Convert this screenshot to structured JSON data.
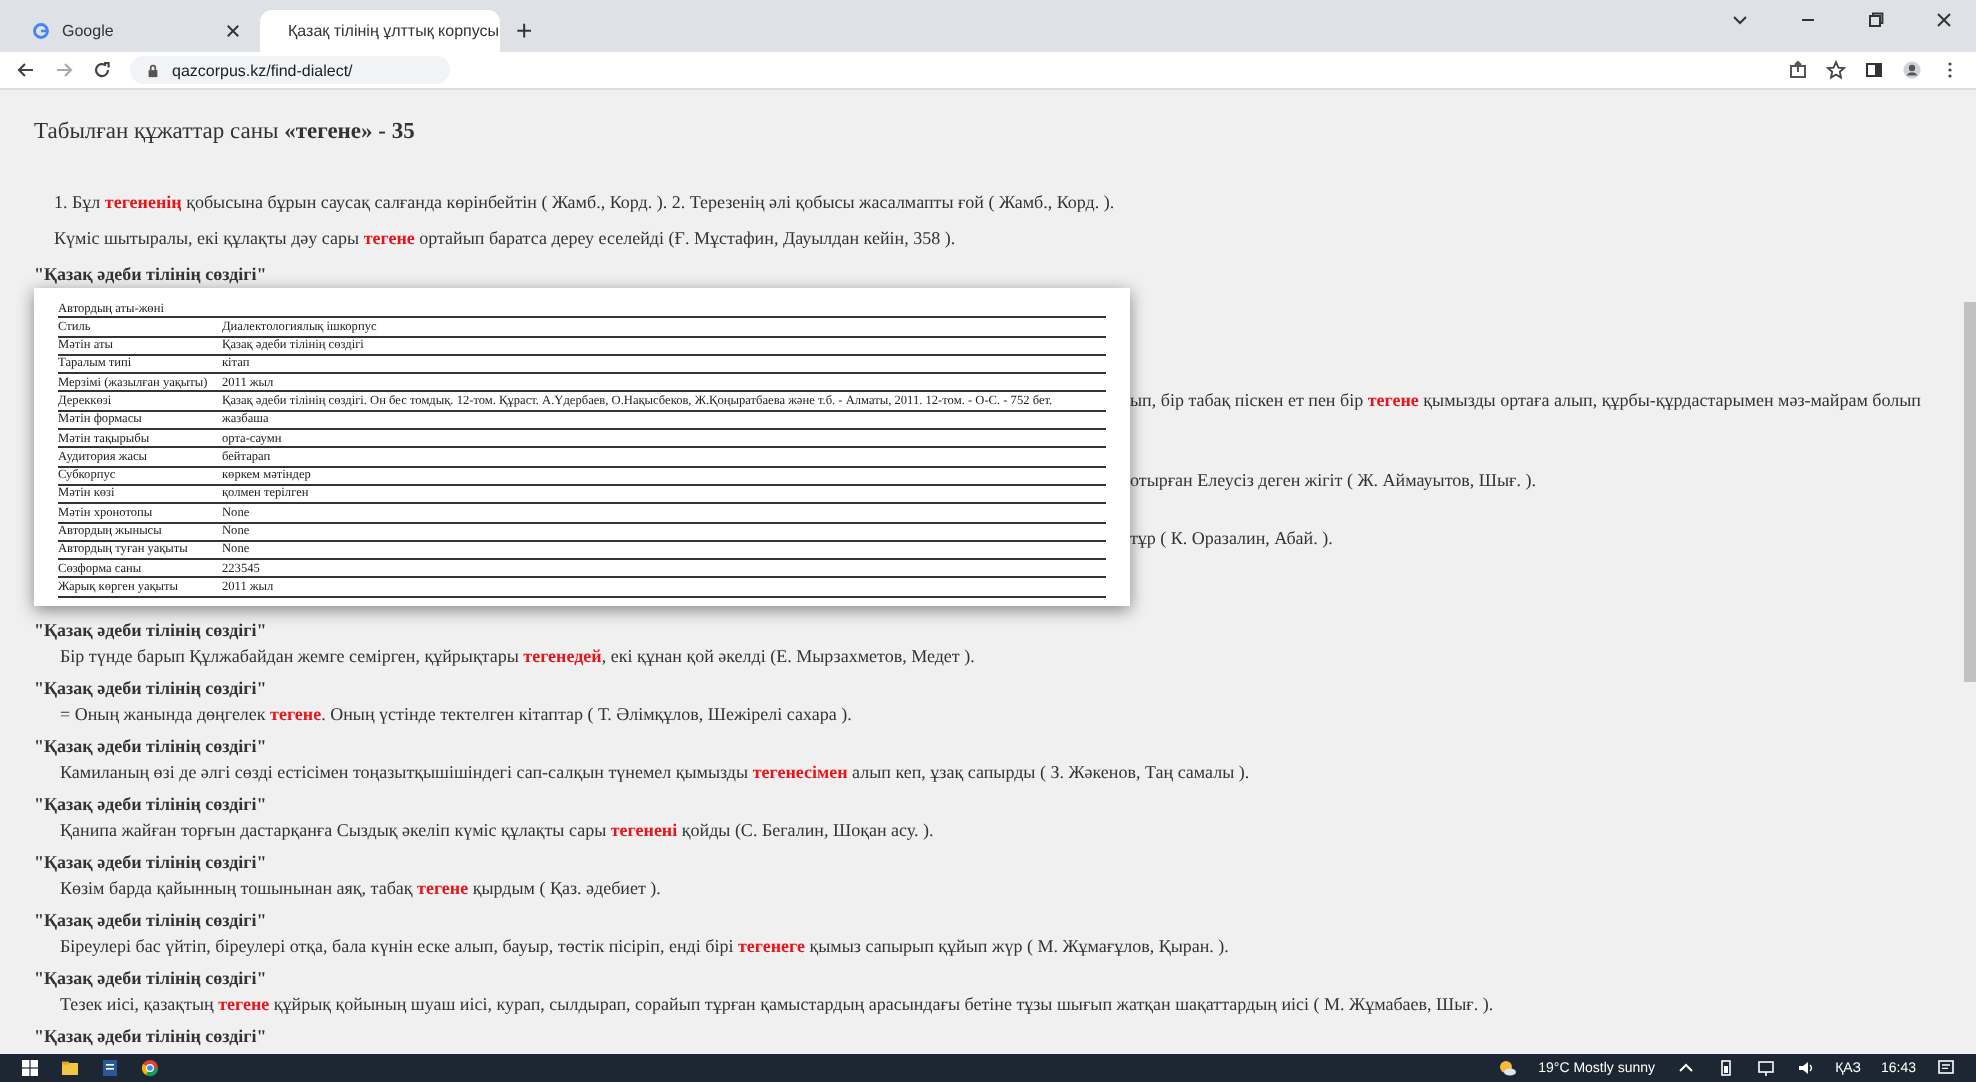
{
  "browser": {
    "tabs": [
      {
        "title": "Google",
        "selected": false
      },
      {
        "title": "Қазақ тілінің ұлттық корпусы",
        "selected": true
      }
    ],
    "new_tab": "+",
    "url": "qazcorpus.kz/find-dialect/"
  },
  "title": "Табылған құжаттар саны **«тегене» - 35**",
  "intro_lines": [
    "1. Бұл **тегененің** қобысына бұрын саусақ салғанда көрінбейтін ( Жамб., Корд. ). 2. Терезенің әлі қобысы жасалмапты ғой ( Жамб., Корд. ).",
    "Күміс шытыралы, екі құлақты дәу сары **тегене** ортайып баратса дереу еселейді (Ғ. Мұстафин, Дауылдан кейін, 358 )."
  ],
  "entries": [
    {
      "kind": "heading",
      "heading": "\"Қазақ әдеби тілінің сөздігі\""
    },
    {
      "kind": "fragment",
      "text": "ып, бір табақ піскен ет пен бір **тегене** қымызды ортаға алып, құрбы-құрдастарымен мәз-майрам болып"
    },
    {
      "kind": "fragment",
      "text": "отырған Елеусіз деген жігіт ( Ж. Аймауытов, Шығ. )."
    },
    {
      "kind": "fragment",
      "text": "тұр ( К. Оразалин, Абай. )."
    },
    {
      "kind": "full",
      "heading": "\"Қазақ әдеби тілінің сөздігі\"",
      "text": "Бір түнде барып Құлжабайдан жемге семірген, құйрықтары **тегенедей**, екі құнан қой әкелді (Е. Мырзахметов, Медет )."
    },
    {
      "kind": "full",
      "heading": "\"Қазақ әдеби тілінің сөздігі\"",
      "text": "= Оның жанында дөңгелек **тегене**. Оның үстінде тектелген кітаптар ( Т. Әлімқұлов, Шежірелі сахара )."
    },
    {
      "kind": "full",
      "heading": "\"Қазақ әдеби тілінің сөздігі\"",
      "text": "Камиланың өзі де әлгі сөзді естісімен тоңазытқышішіндегі сап-салқын түнемел қымызды **тегенесімен** алып кеп, ұзақ сапырды ( З. Жәкенов, Таң самалы )."
    },
    {
      "kind": "full",
      "heading": "\"Қазақ әдеби тілінің сөздігі\"",
      "text": "Қанипа жайған торғын дастарқанға Сыздық әкеліп күміс құлақты сары **тегенені** қойды (С. Бегалин, Шоқан асу. )."
    },
    {
      "kind": "full",
      "heading": "\"Қазақ әдеби тілінің сөздігі\"",
      "text": "Көзім барда қайынның тошынынан аяқ, табақ **тегене** қырдым ( Қаз. әдебиет )."
    },
    {
      "kind": "full",
      "heading": "\"Қазақ әдеби тілінің сөздігі\"",
      "text": "Біреулері бас үйтіп, біреулері отқа, бала күнін еске алып, бауыр, төстік пісіріп, енді бірі **тегенеге** қымыз сапырып құйып жүр ( М. Жұмағұлов, Қыран. )."
    },
    {
      "kind": "full",
      "heading": "\"Қазақ әдеби тілінің сөздігі\"",
      "text": "Тезек иісі, қазақтың **тегене** құйрық қойының шуаш иісі, курап, сылдырап, сорайып тұрған қамыстардың арасындағы бетіне тұзы шығып жатқан шақаттардың иісі ( М. Жұмабаев, Шығ. )."
    },
    {
      "kind": "heading",
      "heading": "\"Қазақ әдеби тілінің сөздігі\""
    }
  ],
  "popup": {
    "rows": [
      {
        "label": "Автордың аты-жөні"
      },
      {
        "label": "Стиль",
        "value": "Диалектологиялық ішкорпус"
      },
      {
        "label": "Мәтін аты",
        "value": "Қазақ әдеби тілінің сөздігі"
      },
      {
        "label": "Таралым типі",
        "value": "кітап"
      },
      {
        "label": "Мерзімі (жазылған уақыты)",
        "value": "2011 жыл"
      },
      {
        "label": "Дереккөзі",
        "value": "Қазақ әдеби тілінің сөздігі. Он бес томдық. 12-том. Құраст. А.Үдербаев, О.Нақысбеков, Ж.Қоңыратбаева және т.б. - Алматы, 2011. 12-том. - О-С. - 752 бет."
      },
      {
        "label": "Мәтін формасы",
        "value": "жазбаша"
      },
      {
        "label": "Мәтін тақырыбы",
        "value": "орта-саумн"
      },
      {
        "label": "Аудитория жасы",
        "value": "бейтарап"
      },
      {
        "label": "Субкорпус",
        "value": "көркем мәтіндер"
      },
      {
        "label": "Мәтін көзі",
        "value": "қолмен терілген"
      },
      {
        "label": "Мәтін хронотопы",
        "value": "None"
      },
      {
        "label": "Автордың жынысы",
        "value": "None"
      },
      {
        "label": "Автордың туған уақыты",
        "value": "None"
      },
      {
        "label": "Сөзформа саны",
        "value": "223545"
      },
      {
        "label": "Жарық көрген уақыты",
        "value": "2011 жыл"
      }
    ]
  },
  "taskbar": {
    "weather": "19°C Mostly sunny",
    "language": "ҚАЗ",
    "time": "16:43"
  }
}
